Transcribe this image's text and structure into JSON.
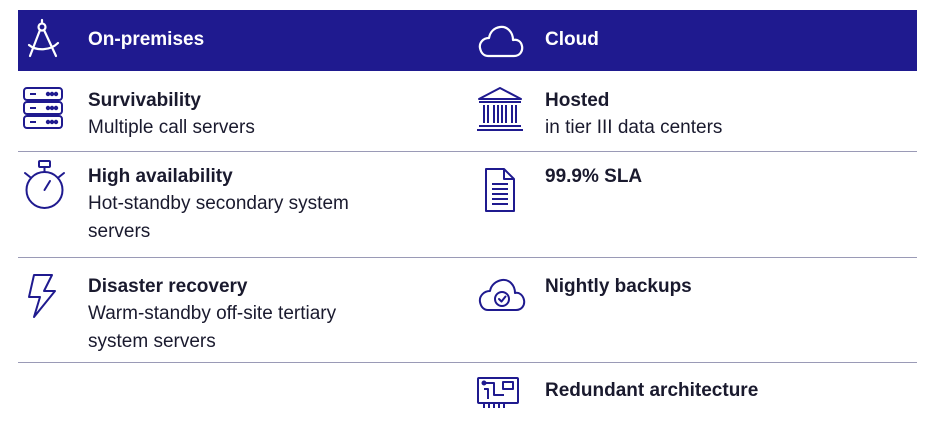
{
  "colors": {
    "header_bg": "#1f1a8f",
    "header_text": "#ffffff",
    "icon_blue": "#1f1a8f",
    "divider": "#9a9ab6"
  },
  "header": {
    "left_title": "On-premises",
    "left_icon": "drafting-compass-icon",
    "right_title": "Cloud",
    "right_icon": "cloud-icon"
  },
  "rows": [
    {
      "left": {
        "icon": "server-rack-icon",
        "title": "Survivability",
        "desc": "Multiple call servers"
      },
      "right": {
        "icon": "building-columns-icon",
        "title": "Hosted",
        "desc": "in tier III data centers"
      }
    },
    {
      "left": {
        "icon": "stopwatch-icon",
        "title": "High availability",
        "desc": "Hot-standby secondary system servers"
      },
      "right": {
        "icon": "document-icon",
        "title": "99.9% SLA",
        "desc": ""
      }
    },
    {
      "left": {
        "icon": "lightning-bolt-icon",
        "title": "Disaster recovery",
        "desc": "Warm-standby off-site tertiary system servers"
      },
      "right": {
        "icon": "cloud-check-icon",
        "title": "Nightly backups",
        "desc": ""
      }
    },
    {
      "left": {
        "icon": "",
        "title": "",
        "desc": ""
      },
      "right": {
        "icon": "circuit-board-icon",
        "title": "Redundant architecture",
        "desc": ""
      }
    }
  ]
}
